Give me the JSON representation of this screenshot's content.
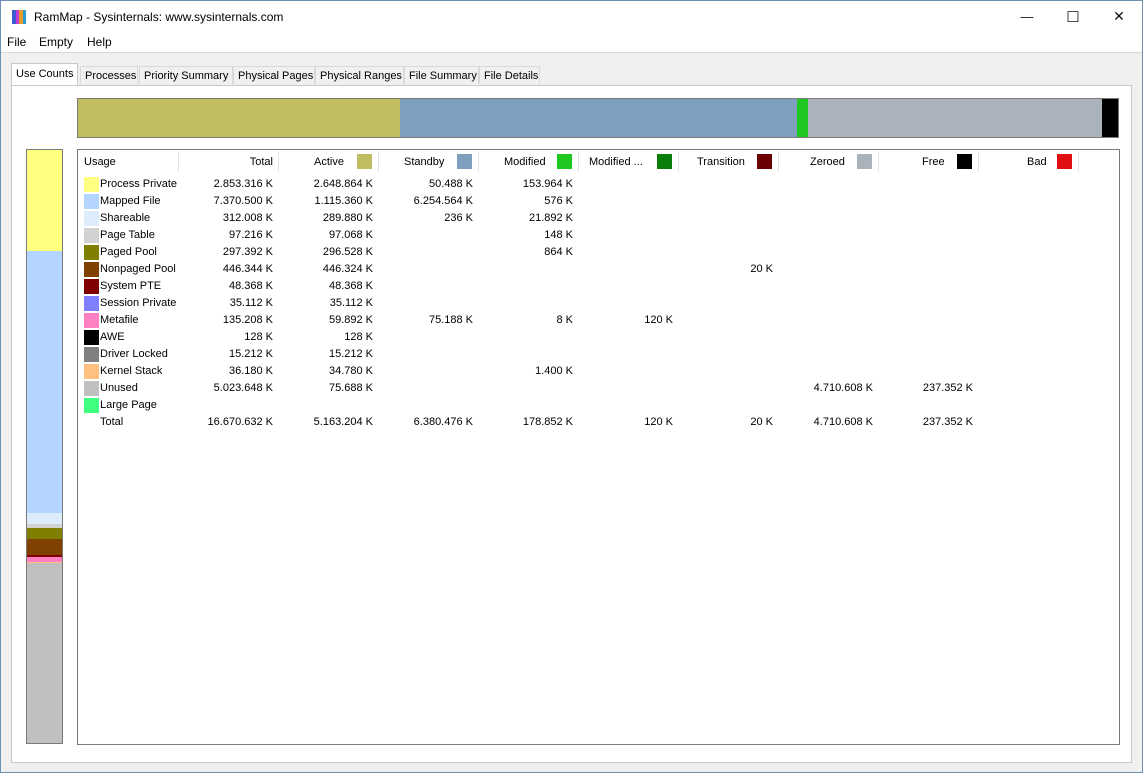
{
  "window": {
    "title": "RamMap - Sysinternals: www.sysinternals.com",
    "icon_name": "rammap-app-icon",
    "icon_colors": [
      "#3c5bd1",
      "#c23ad6",
      "#e59b2a",
      "#2a9ad6"
    ],
    "controls": {
      "minimize": "—",
      "maximize": "☐",
      "close": "✕"
    }
  },
  "menu": [
    "File",
    "Empty",
    "Help"
  ],
  "tabs": [
    "Use Counts",
    "Processes",
    "Priority Summary",
    "Physical Pages",
    "Physical Ranges",
    "File Summary",
    "File Details"
  ],
  "active_tab": "Use Counts",
  "columns": [
    {
      "label": "Usage",
      "color": null
    },
    {
      "label": "Total",
      "color": null
    },
    {
      "label": "Active",
      "color": "#c0bd62"
    },
    {
      "label": "Standby",
      "color": "#7f9fbf"
    },
    {
      "label": "Modified",
      "color": "#1ec81e"
    },
    {
      "label": "Modified ...",
      "color": "#0a7d0a"
    },
    {
      "label": "Transition",
      "color": "#6b0000"
    },
    {
      "label": "Zeroed",
      "color": "#aab2bb"
    },
    {
      "label": "Free",
      "color": "#000000"
    },
    {
      "label": "Bad",
      "color": "#e01010"
    }
  ],
  "rows": [
    {
      "name": "Process Private",
      "color": "#ffff80",
      "values": [
        "2.853.316 K",
        "2.648.864 K",
        "50.488 K",
        "153.964 K",
        "",
        "",
        "",
        "",
        ""
      ]
    },
    {
      "name": "Mapped File",
      "color": "#b3d5ff",
      "values": [
        "7.370.500 K",
        "1.115.360 K",
        "6.254.564 K",
        "576 K",
        "",
        "",
        "",
        "",
        ""
      ]
    },
    {
      "name": "Shareable",
      "color": "#dcecfb",
      "values": [
        "312.008 K",
        "289.880 K",
        "236 K",
        "21.892 K",
        "",
        "",
        "",
        "",
        ""
      ]
    },
    {
      "name": "Page Table",
      "color": "#d2d2d2",
      "values": [
        "97.216 K",
        "97.068 K",
        "",
        "148 K",
        "",
        "",
        "",
        "",
        ""
      ]
    },
    {
      "name": "Paged Pool",
      "color": "#808000",
      "values": [
        "297.392 K",
        "296.528 K",
        "",
        "864 K",
        "",
        "",
        "",
        "",
        ""
      ]
    },
    {
      "name": "Nonpaged Pool",
      "color": "#804000",
      "values": [
        "446.344 K",
        "446.324 K",
        "",
        "",
        "",
        "20 K",
        "",
        "",
        ""
      ]
    },
    {
      "name": "System PTE",
      "color": "#800000",
      "values": [
        "48.368 K",
        "48.368 K",
        "",
        "",
        "",
        "",
        "",
        "",
        ""
      ]
    },
    {
      "name": "Session Private",
      "color": "#8080ff",
      "values": [
        "35.112 K",
        "35.112 K",
        "",
        "",
        "",
        "",
        "",
        "",
        ""
      ]
    },
    {
      "name": "Metafile",
      "color": "#ff80c0",
      "values": [
        "135.208 K",
        "59.892 K",
        "75.188 K",
        "8 K",
        "120 K",
        "",
        "",
        "",
        ""
      ]
    },
    {
      "name": "AWE",
      "color": "#000000",
      "values": [
        "128 K",
        "128 K",
        "",
        "",
        "",
        "",
        "",
        "",
        ""
      ]
    },
    {
      "name": "Driver Locked",
      "color": "#808080",
      "values": [
        "15.212 K",
        "15.212 K",
        "",
        "",
        "",
        "",
        "",
        "",
        ""
      ]
    },
    {
      "name": "Kernel Stack",
      "color": "#ffc080",
      "values": [
        "36.180 K",
        "34.780 K",
        "",
        "1.400 K",
        "",
        "",
        "",
        "",
        ""
      ]
    },
    {
      "name": "Unused",
      "color": "#c0c0c0",
      "values": [
        "5.023.648 K",
        "75.688 K",
        "",
        "",
        "",
        "",
        "4.710.608 K",
        "237.352 K",
        ""
      ]
    },
    {
      "name": "Large Page",
      "color": "#40ff80",
      "values": [
        "",
        "",
        "",
        "",
        "",
        "",
        "",
        "",
        ""
      ]
    },
    {
      "name": "Total",
      "color": null,
      "values": [
        "16.670.632 K",
        "5.163.204 K",
        "6.380.476 K",
        "178.852 K",
        "120 K",
        "20 K",
        "4.710.608 K",
        "237.352 K",
        ""
      ]
    }
  ]
}
